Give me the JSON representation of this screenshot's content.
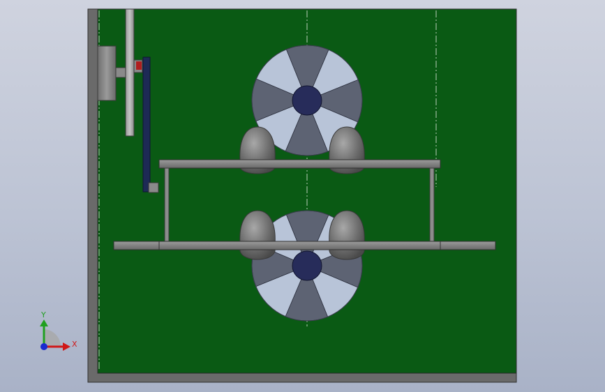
{
  "viewport": {
    "background_top": "#cfd3df",
    "background_bottom": "#a9b2c7"
  },
  "model": {
    "plate_color": "#0a5a14",
    "frame_color": "#6b6b6b",
    "steel_color": "#8c8c8c",
    "blade_light": "#b8c4d8",
    "blade_dark": "#5d6373",
    "hub_color": "#272c5a",
    "roller_color": "#7a7a7a",
    "belt_color": "#1d2a55",
    "bolt_color": "#b01e1e"
  },
  "triad": {
    "x_label": "X",
    "y_label": "Y",
    "x_color": "#d01818",
    "y_color": "#20a020",
    "z_color": "#1a2ad0"
  }
}
